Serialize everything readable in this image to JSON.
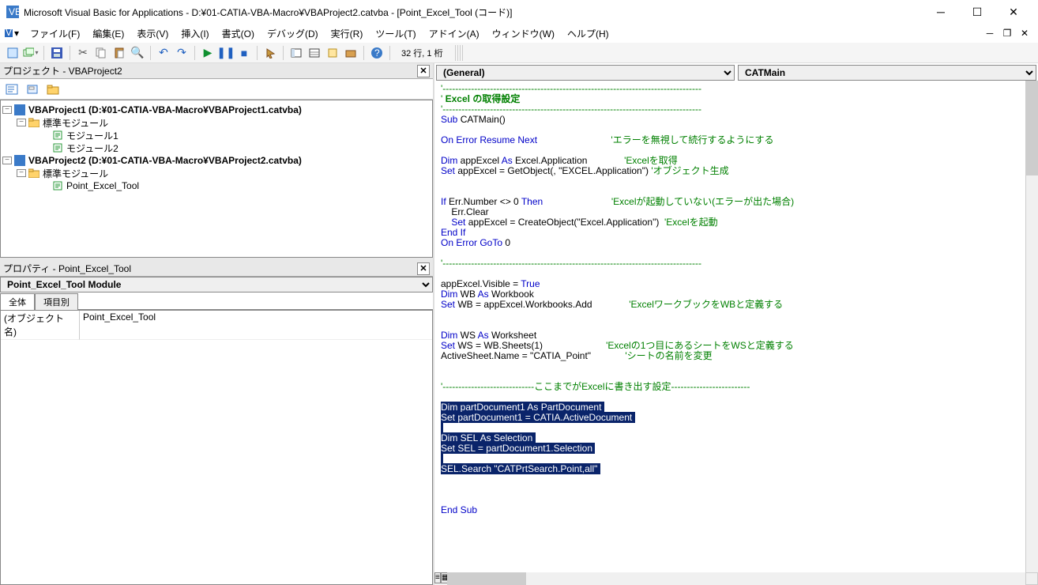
{
  "window": {
    "title": "Microsoft Visual Basic for Applications - D:¥01-CATIA-VBA-Macro¥VBAProject2.catvba - [Point_Excel_Tool (コード)]"
  },
  "menu": {
    "file": "ファイル(F)",
    "edit": "編集(E)",
    "view": "表示(V)",
    "insert": "挿入(I)",
    "format": "書式(O)",
    "debug": "デバッグ(D)",
    "run": "実行(R)",
    "tools": "ツール(T)",
    "addins": "アドイン(A)",
    "window": "ウィンドウ(W)",
    "help": "ヘルプ(H)"
  },
  "toolbar": {
    "status": "32 行, 1 桁"
  },
  "project_panel": {
    "title": "プロジェクト - VBAProject2",
    "tree": {
      "p1": "VBAProject1 (D:¥01-CATIA-VBA-Macro¥VBAProject1.catvba)",
      "p1_folder": "標準モジュール",
      "p1_m1": "モジュール1",
      "p1_m2": "モジュール2",
      "p2": "VBAProject2 (D:¥01-CATIA-VBA-Macro¥VBAProject2.catvba)",
      "p2_folder": "標準モジュール",
      "p2_m1": "Point_Excel_Tool"
    }
  },
  "prop_panel": {
    "title": "プロパティ - Point_Excel_Tool",
    "object": "Point_Excel_Tool Module",
    "obj_name": "Point_Excel_Tool",
    "obj_suffix": " Module",
    "tab_all": "全体",
    "tab_cat": "項目別",
    "key_name": "(オブジェクト名)",
    "val_name": "Point_Excel_Tool"
  },
  "code": {
    "left_combo": "(General)",
    "right_combo": "CATMain",
    "lines": [
      {
        "t": "'----------------------------------------------------------------------------------",
        "c": "cm"
      },
      {
        "segs": [
          {
            "t": "' ",
            "c": "cm"
          },
          {
            "t": "Excel の取得設定",
            "c": "cm b"
          }
        ]
      },
      {
        "t": "'----------------------------------------------------------------------------------",
        "c": "cm"
      },
      {
        "segs": [
          {
            "t": "Sub",
            "c": "kw"
          },
          {
            "t": " CATMain()"
          }
        ]
      },
      {
        "t": ""
      },
      {
        "segs": [
          {
            "t": "On Error Resume Next",
            "c": "kw"
          },
          {
            "t": "                            "
          },
          {
            "t": "'エラーを無視して続行するようにする",
            "c": "cm"
          }
        ]
      },
      {
        "t": ""
      },
      {
        "segs": [
          {
            "t": "Dim",
            "c": "kw"
          },
          {
            "t": " appExcel "
          },
          {
            "t": "As",
            "c": "kw"
          },
          {
            "t": " Excel.Application              "
          },
          {
            "t": "'Excelを取得",
            "c": "cm"
          }
        ]
      },
      {
        "segs": [
          {
            "t": "Set",
            "c": "kw"
          },
          {
            "t": " appExcel = GetObject(, \"EXCEL.Application\") "
          },
          {
            "t": "'オブジェクト生成",
            "c": "cm"
          }
        ]
      },
      {
        "t": ""
      },
      {
        "t": ""
      },
      {
        "segs": [
          {
            "t": "If",
            "c": "kw"
          },
          {
            "t": " Err.Number <> 0 "
          },
          {
            "t": "Then",
            "c": "kw"
          },
          {
            "t": "                          "
          },
          {
            "t": "'Excelが起動していない(エラーが出た場合)",
            "c": "cm"
          }
        ]
      },
      {
        "segs": [
          {
            "t": "    Err.Clear"
          }
        ]
      },
      {
        "segs": [
          {
            "t": "    "
          },
          {
            "t": "Set",
            "c": "kw"
          },
          {
            "t": " appExcel = CreateObject(\"Excel.Application\")  "
          },
          {
            "t": "'Excelを起動",
            "c": "cm"
          }
        ]
      },
      {
        "segs": [
          {
            "t": "End If",
            "c": "kw"
          }
        ]
      },
      {
        "segs": [
          {
            "t": "On Error GoTo",
            "c": "kw"
          },
          {
            "t": " 0"
          }
        ]
      },
      {
        "t": ""
      },
      {
        "t": "'----------------------------------------------------------------------------------",
        "c": "cm"
      },
      {
        "t": ""
      },
      {
        "segs": [
          {
            "t": "appExcel.Visible = "
          },
          {
            "t": "True",
            "c": "kw"
          }
        ]
      },
      {
        "segs": [
          {
            "t": "Dim",
            "c": "kw"
          },
          {
            "t": " WB "
          },
          {
            "t": "As",
            "c": "kw"
          },
          {
            "t": " Workbook"
          }
        ]
      },
      {
        "segs": [
          {
            "t": "Set",
            "c": "kw"
          },
          {
            "t": " WB = appExcel.Workbooks.Add              "
          },
          {
            "t": "'ExcelワークブックをWBと定義する",
            "c": "cm"
          }
        ]
      },
      {
        "t": ""
      },
      {
        "t": ""
      },
      {
        "segs": [
          {
            "t": "Dim",
            "c": "kw"
          },
          {
            "t": " WS "
          },
          {
            "t": "As",
            "c": "kw"
          },
          {
            "t": " Worksheet"
          }
        ]
      },
      {
        "segs": [
          {
            "t": "Set",
            "c": "kw"
          },
          {
            "t": " WS = WB.Sheets(1)                        "
          },
          {
            "t": "'Excelの1つ目にあるシートをWSと定義する",
            "c": "cm"
          }
        ]
      },
      {
        "segs": [
          {
            "t": "ActiveSheet.Name = \"CATIA_Point\"             "
          },
          {
            "t": "'シートの名前を変更",
            "c": "cm"
          }
        ]
      },
      {
        "t": ""
      },
      {
        "t": ""
      },
      {
        "t": "'-----------------------------ここまでがExcelに書き出す設定-------------------------",
        "c": "cm"
      },
      {
        "t": ""
      },
      {
        "segs": [
          {
            "t": "Dim partDocument1 As PartDocument ",
            "c": "sel"
          }
        ]
      },
      {
        "segs": [
          {
            "t": "Set partDocument1 = CATIA.ActiveDocument ",
            "c": "sel"
          }
        ]
      },
      {
        "segs": [
          {
            "t": " ",
            "c": "sel"
          }
        ]
      },
      {
        "segs": [
          {
            "t": "Dim SEL As Selection ",
            "c": "sel"
          }
        ]
      },
      {
        "segs": [
          {
            "t": "Set SEL = partDocument1.Selection ",
            "c": "sel"
          }
        ]
      },
      {
        "segs": [
          {
            "t": " ",
            "c": "sel"
          }
        ]
      },
      {
        "segs": [
          {
            "t": "SEL.Search \"CATPrtSearch.Point,all\" ",
            "c": "sel"
          }
        ]
      },
      {
        "t": ""
      },
      {
        "t": ""
      },
      {
        "t": ""
      },
      {
        "segs": [
          {
            "t": "End Sub",
            "c": "kw"
          }
        ]
      }
    ]
  }
}
